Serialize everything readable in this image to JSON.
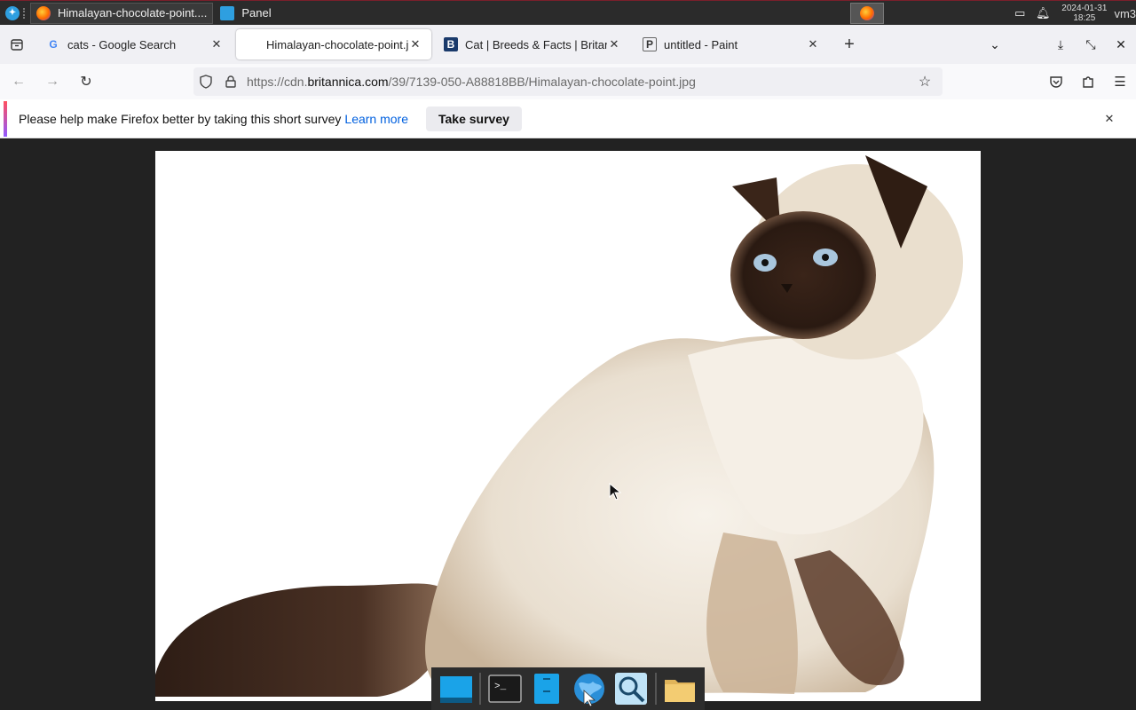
{
  "system_panel": {
    "tasks": [
      {
        "label": "Himalayan-chocolate-point....",
        "icon": "firefox-icon"
      },
      {
        "label": "Panel",
        "icon": "panel-icon"
      }
    ],
    "clock_date": "2024-01-31",
    "clock_time": "18:25",
    "user": "vm3"
  },
  "tabs": [
    {
      "label": "cats - Google Search",
      "favicon": "G"
    },
    {
      "label": "Himalayan-chocolate-point.jpg",
      "favicon": ""
    },
    {
      "label": "Cat | Breeds & Facts | Britannica",
      "favicon": "B"
    },
    {
      "label": "untitled - Paint",
      "favicon": "P"
    }
  ],
  "urlbar": {
    "prefix": "https://cdn.",
    "domain": "britannica.com",
    "path": "/39/7139-050-A88818BB/Himalayan-chocolate-point.jpg"
  },
  "notification": {
    "text": "Please help make Firefox better by taking this short survey",
    "link": "Learn more",
    "button": "Take survey"
  },
  "image": {
    "subject": "himalayan-chocolate-point-cat"
  },
  "dock": {
    "items": [
      "desktop",
      "terminal",
      "files-panel",
      "browser",
      "search",
      "folder"
    ]
  },
  "colors": {
    "accent": "#0060df",
    "panel_bg": "#2b2b2b",
    "content_bg": "#222222"
  }
}
